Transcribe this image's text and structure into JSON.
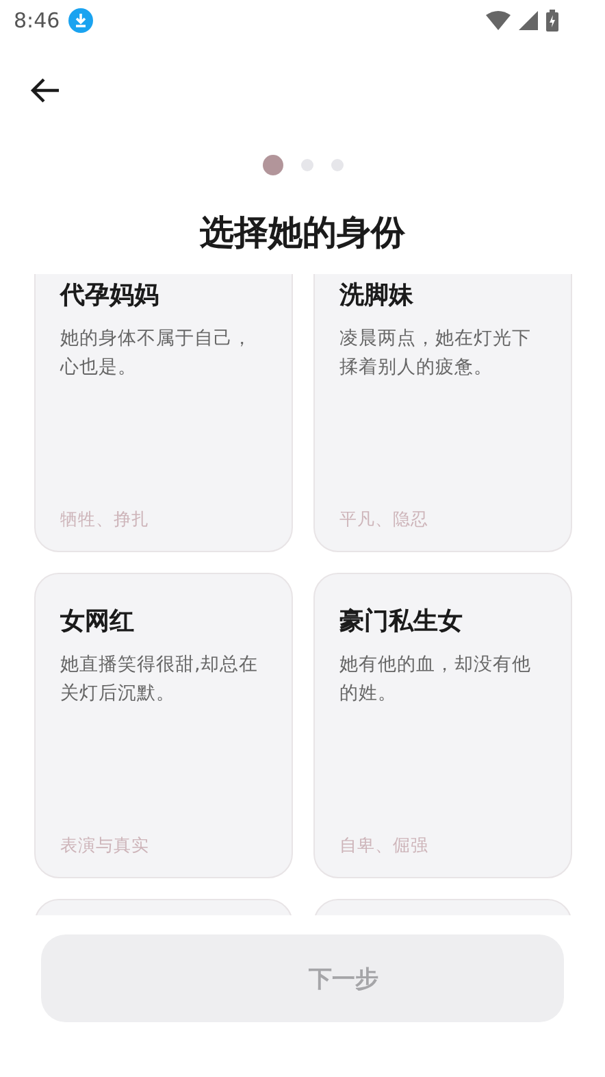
{
  "status_bar": {
    "time": "8:46"
  },
  "steps": [
    {
      "selected": true
    },
    {
      "selected": false
    },
    {
      "selected": false
    }
  ],
  "title": "选择她的身份",
  "cards": [
    {
      "title": "代孕妈妈",
      "description": "她的身体不属于自己，心也是。",
      "tags": "牺牲、挣扎",
      "selected": false
    },
    {
      "title": "洗脚妹",
      "description": "凌晨两点，她在灯光下揉着别人的疲惫。",
      "tags": "平凡、隐忍",
      "selected": false
    },
    {
      "title": "女网红",
      "description": "她直播笑得很甜,却总在关灯后沉默。",
      "tags": "表演与真实",
      "selected": false
    },
    {
      "title": "豪门私生女",
      "description": "她有他的血，却没有他的姓。",
      "tags": "自卑、倔强",
      "selected": false
    }
  ],
  "more_cards_below": true,
  "next_button": {
    "label": "下一步",
    "disabled": true
  }
}
